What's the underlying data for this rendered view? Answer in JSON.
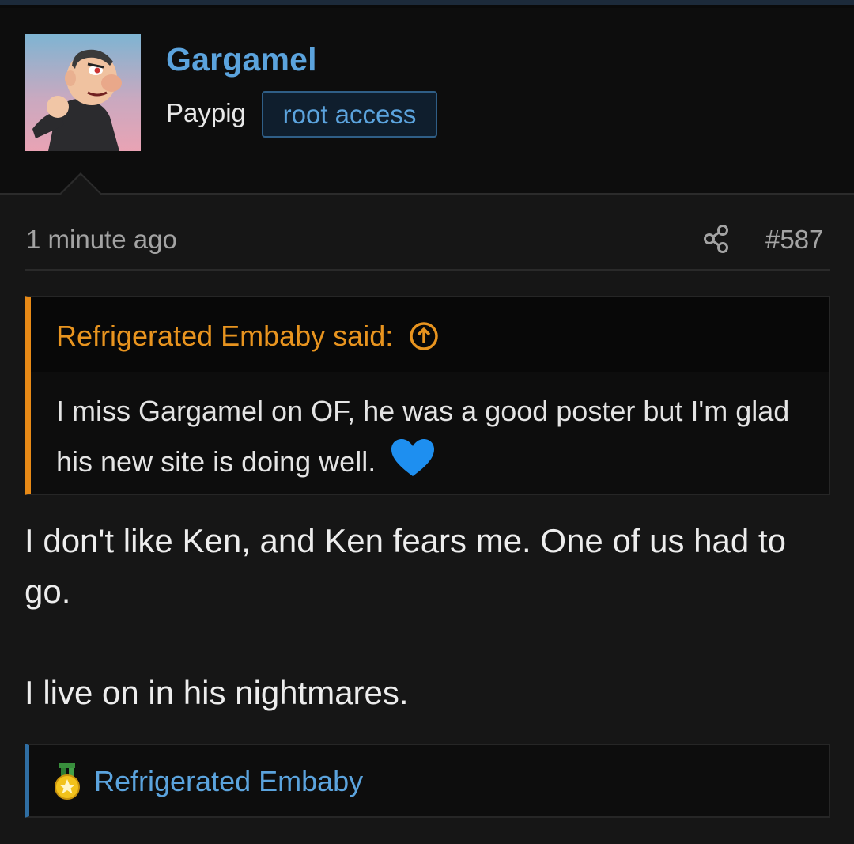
{
  "post": {
    "author": {
      "name": "Gargamel",
      "user_title": "Paypig",
      "badge": "root access",
      "avatar_icon": "gargamel-avatar"
    },
    "timestamp": "1 minute ago",
    "post_number": "#587",
    "quote": {
      "attribution": "Refrigerated Embaby said:",
      "text": "I miss Gargamel on OF, he was a good poster but I'm glad his new site is doing well.",
      "emoji": "blue-heart"
    },
    "body": {
      "line1": "I don't like Ken, and Ken fears me. One of us had to go.",
      "line2": "I live on in his nightmares."
    },
    "reactions": {
      "icon": "medal-icon",
      "user": "Refrigerated Embaby"
    }
  },
  "colors": {
    "link_blue": "#5ba3dd",
    "quote_accent": "#e88a17",
    "background": "#161616"
  }
}
